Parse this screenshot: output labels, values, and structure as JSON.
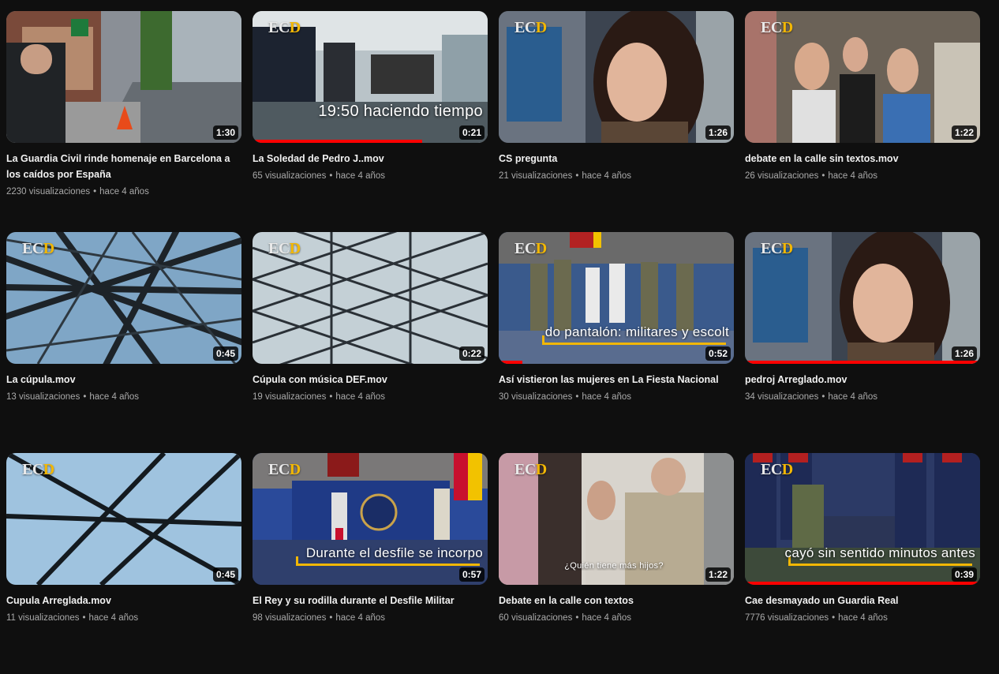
{
  "videos": [
    {
      "title": "La Guardia Civil rinde homenaje en Barcelona a los caídos por España",
      "views": "2230 visualizaciones",
      "age": "hace 4 años",
      "duration": "1:30",
      "logo": "",
      "caption": "",
      "progress": 0,
      "scene": "street"
    },
    {
      "title": "La Soledad de Pedro J..mov",
      "views": "65 visualizaciones",
      "age": "hace 4 años",
      "duration": "0:21",
      "logo": "ECD",
      "caption": "19:50 haciendo tiempo",
      "progress": 0.72,
      "scene": "airport"
    },
    {
      "title": "CS pregunta",
      "views": "21 visualizaciones",
      "age": "hace 4 años",
      "duration": "1:26",
      "logo": "ECD",
      "caption": "",
      "progress": 0,
      "scene": "woman"
    },
    {
      "title": "debate en la calle sin textos.mov",
      "views": "26 visualizaciones",
      "age": "hace 4 años",
      "duration": "1:22",
      "logo": "ECD",
      "caption": "",
      "progress": 0,
      "scene": "crowd"
    },
    {
      "title": "La cúpula.mov",
      "views": "13 visualizaciones",
      "age": "hace 4 años",
      "duration": "0:45",
      "logo": "ECD",
      "caption": "",
      "progress": 0,
      "scene": "dome"
    },
    {
      "title": "Cúpula con música DEF.mov",
      "views": "19 visualizaciones",
      "age": "hace 4 años",
      "duration": "0:22",
      "logo": "ECD",
      "caption": "",
      "progress": 0,
      "scene": "dome2"
    },
    {
      "title": "Así vistieron las mujeres en La Fiesta Nacional",
      "views": "30 visualizaciones",
      "age": "hace 4 años",
      "duration": "0:52",
      "logo": "ECD",
      "caption": "do pantalón: militares y escolt",
      "progress": 0.1,
      "scene": "parade"
    },
    {
      "title": "pedroj Arreglado.mov",
      "views": "34 visualizaciones",
      "age": "hace 4 años",
      "duration": "1:26",
      "logo": "ECD",
      "caption": "",
      "progress": 1,
      "scene": "woman"
    },
    {
      "title": "Cupula Arreglada.mov",
      "views": "11 visualizaciones",
      "age": "hace 4 años",
      "duration": "0:45",
      "logo": "ECD",
      "caption": "",
      "progress": 0,
      "scene": "dome3"
    },
    {
      "title": "El Rey y su rodilla durante el Desfile Militar",
      "views": "98 visualizaciones",
      "age": "hace 4 años",
      "duration": "0:57",
      "logo": "ECD",
      "caption": "Durante el desfile se incorpo",
      "progress": 0,
      "scene": "stage"
    },
    {
      "title": "Debate en la calle con textos",
      "views": "60 visualizaciones",
      "age": "hace 4 años",
      "duration": "1:22",
      "logo": "ECD",
      "caption": "¿Quién tiene más hijos?",
      "progress": 0,
      "scene": "crowd2"
    },
    {
      "title": "Cae desmayado un Guardia Real",
      "views": "7776 visualizaciones",
      "age": "hace 4 años",
      "duration": "0:39",
      "logo": "ECD",
      "caption": "cayó sin sentido minutos antes",
      "progress": 1,
      "scene": "guards"
    }
  ]
}
